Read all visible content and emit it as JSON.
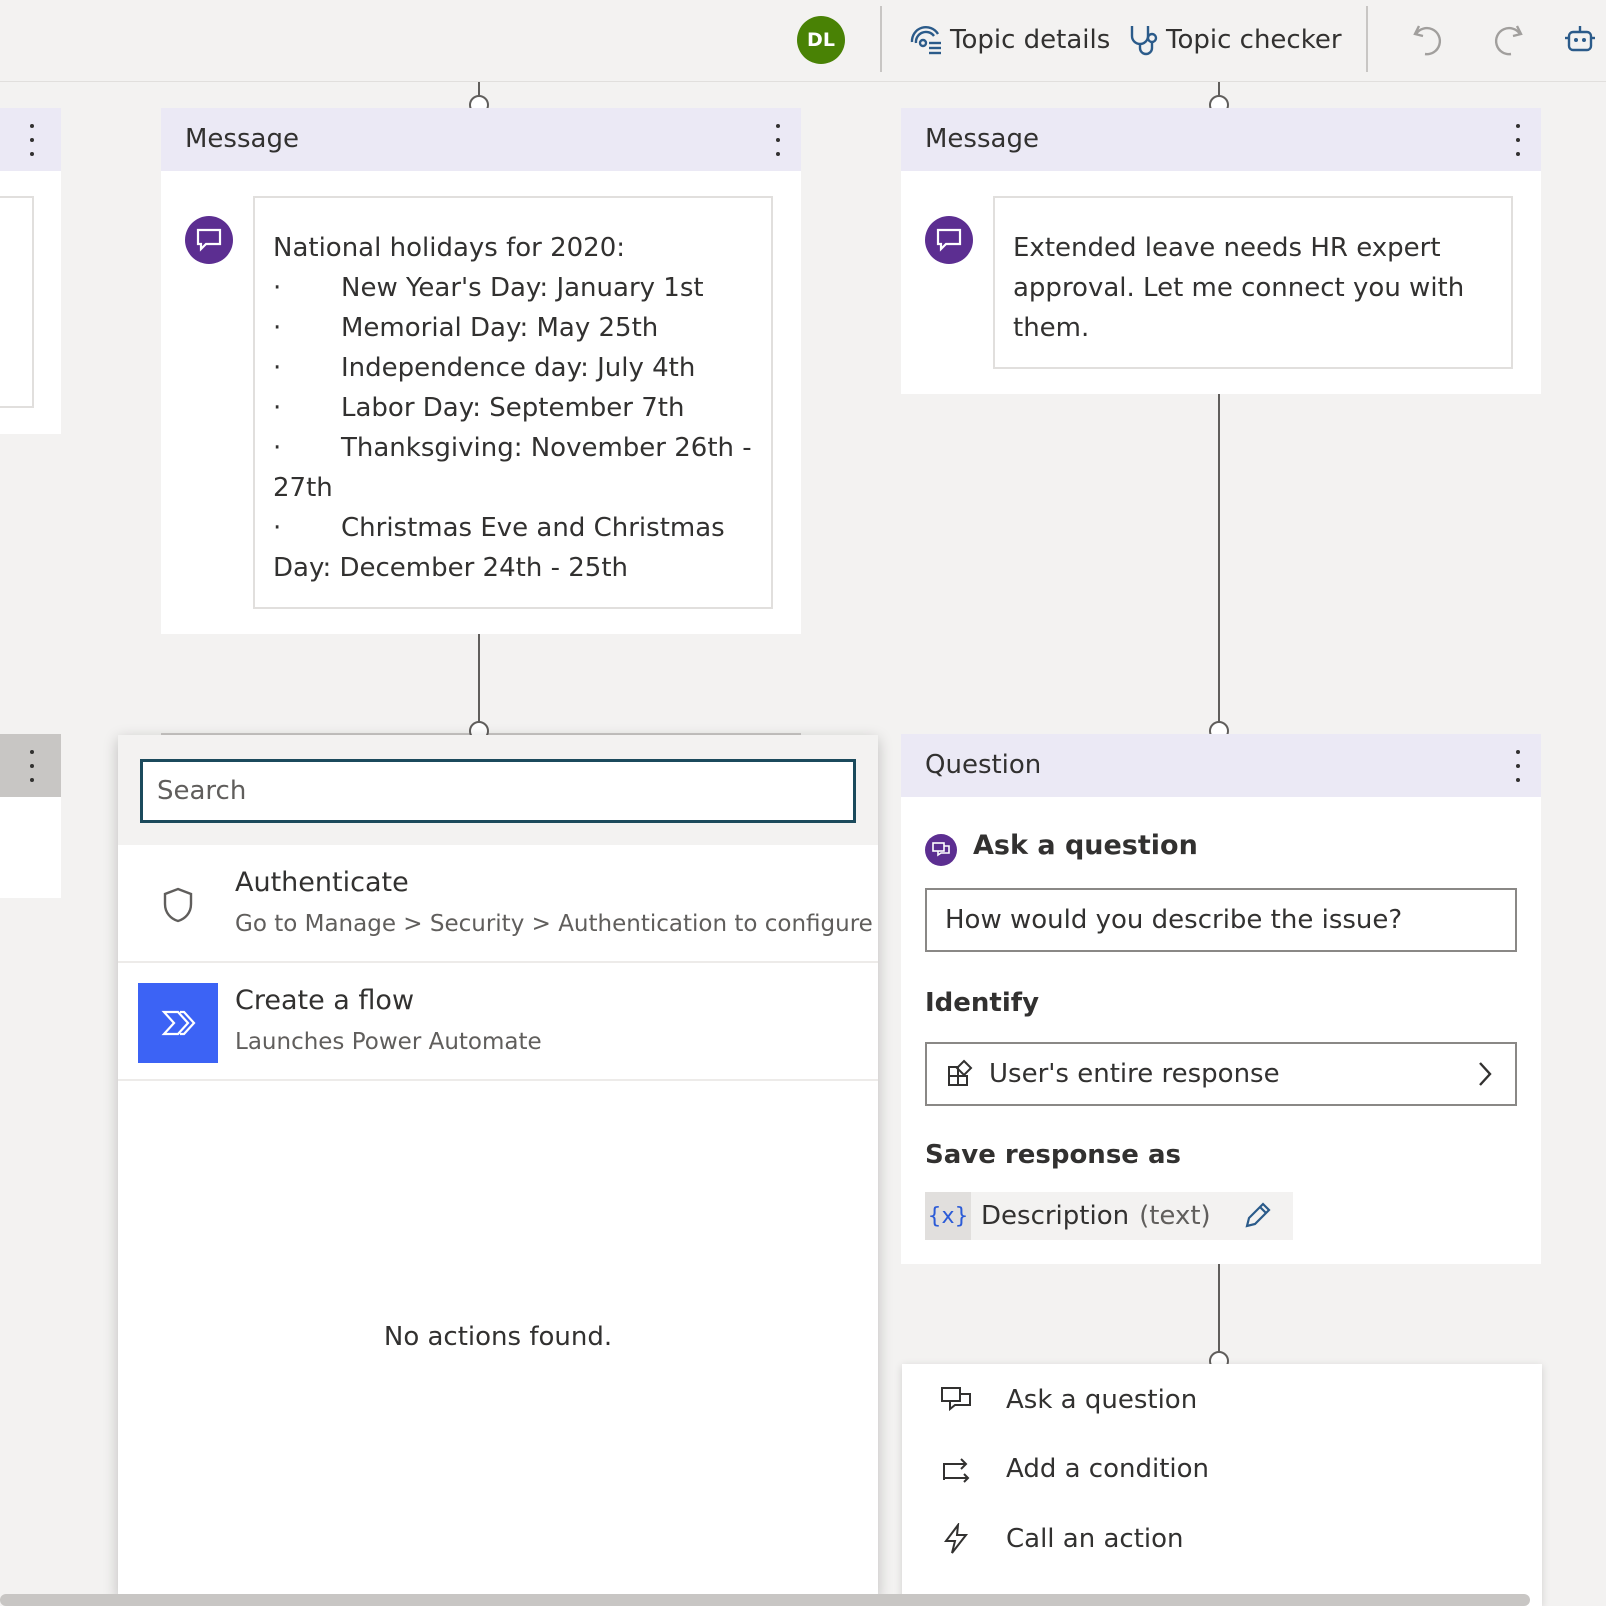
{
  "topbar": {
    "avatar_initials": "DL",
    "topic_details": "Topic details",
    "topic_checker": "Topic checker"
  },
  "message_left": {
    "title": "Message",
    "lines": [
      {
        "bullet": "",
        "text": "National holidays for 2020:"
      },
      {
        "bullet": "·",
        "text": "New Year's Day: January 1st"
      },
      {
        "bullet": "·",
        "text": "Memorial Day: May 25th"
      },
      {
        "bullet": "·",
        "text": "Independence day: July 4th"
      },
      {
        "bullet": "·",
        "text": "Labor Day: September 7th"
      },
      {
        "bullet": "·",
        "text": "Thanksgiving: November 26th -"
      },
      {
        "bullet": "",
        "text": "27th"
      },
      {
        "bullet": "·",
        "text": "Christmas Eve and Christmas"
      },
      {
        "bullet": "",
        "text": "Day: December 24th - 25th"
      }
    ]
  },
  "message_right": {
    "title": "Message",
    "lines": [
      "Extended leave needs HR expert",
      "approval.  Let me connect you with",
      "them."
    ]
  },
  "action_panel": {
    "search_placeholder": "Search",
    "items": [
      {
        "title": "Authenticate",
        "subtitle": "Go to Manage > Security > Authentication to configure",
        "icon": "shield-icon"
      },
      {
        "title": "Create a flow",
        "subtitle": "Launches Power Automate",
        "icon": "power-automate-icon",
        "icon_bg": "#3c63f5"
      }
    ],
    "empty_text": "No actions found."
  },
  "question": {
    "title": "Question",
    "ask_label": "Ask a question",
    "question_text": "How would you describe the issue?",
    "identify_label": "Identify",
    "identify_value": "User's entire response",
    "save_label": "Save response as",
    "var_symbol": "{x}",
    "var_name": "Description",
    "var_type": "(text)"
  },
  "add_menu": {
    "items": [
      "Ask a question",
      "Add a condition",
      "Call an action"
    ]
  },
  "colors": {
    "accent_purple": "#5c2e91",
    "avatar_green": "#498205",
    "card_header": "#ebe9f5",
    "flow_blue": "#3c63f5",
    "search_border": "#1b4a5c"
  }
}
